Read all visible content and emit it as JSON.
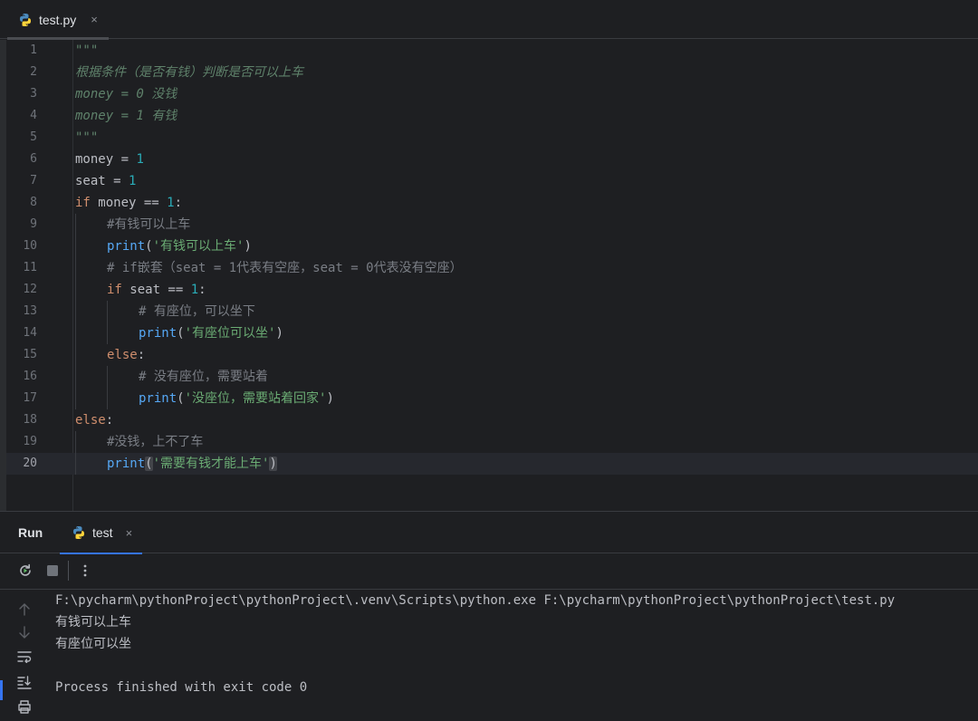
{
  "editor_tab": {
    "label": "test.py",
    "close": "×",
    "icon": "python-icon"
  },
  "code": {
    "line_numbers": [
      "1",
      "2",
      "3",
      "4",
      "5",
      "6",
      "7",
      "8",
      "9",
      "10",
      "11",
      "12",
      "13",
      "14",
      "15",
      "16",
      "17",
      "18",
      "19",
      "20"
    ],
    "current_line": "20",
    "lines": {
      "l1": "\"\"\"",
      "l2": "根据条件（是否有钱）判断是否可以上车",
      "l3": "money = 0 没钱",
      "l4": "money = 1 有钱",
      "l5": "\"\"\"",
      "l6_a": "money = ",
      "l6_b": "1",
      "l7_a": "seat = ",
      "l7_b": "1",
      "l8_a": "if",
      "l8_b": " money == ",
      "l8_c": "1",
      "l8_d": ":",
      "l9": "#有钱可以上车",
      "l10_a": "print",
      "l10_b": "(",
      "l10_c": "'有钱可以上车'",
      "l10_d": ")",
      "l11": "# if嵌套（seat = 1代表有空座，seat = 0代表没有空座）",
      "l12_a": "if",
      "l12_b": " seat == ",
      "l12_c": "1",
      "l12_d": ":",
      "l13": "# 有座位，可以坐下",
      "l14_a": "print",
      "l14_b": "(",
      "l14_c": "'有座位可以坐'",
      "l14_d": ")",
      "l15_a": "else",
      "l15_b": ":",
      "l16": "# 没有座位，需要站着",
      "l17_a": "print",
      "l17_b": "(",
      "l17_c": "'没座位，需要站着回家'",
      "l17_d": ")",
      "l18_a": "else",
      "l18_b": ":",
      "l19": "#没钱，上不了车",
      "l20_a": "print",
      "l20_b": "(",
      "l20_c": "'需要有钱才能上车'",
      "l20_d": ")"
    }
  },
  "run_panel": {
    "title": "Run",
    "tab": {
      "label": "test",
      "close": "×",
      "icon": "python-icon"
    },
    "toolbar": [
      "rerun-icon",
      "stop-icon",
      "more-options-icon"
    ],
    "side_tools": [
      "scroll-up-icon",
      "scroll-down-icon",
      "soft-wrap-icon",
      "scroll-to-end-icon",
      "print-icon"
    ],
    "console": [
      "F:\\pycharm\\pythonProject\\pythonProject\\.venv\\Scripts\\python.exe F:\\pycharm\\pythonProject\\pythonProject\\test.py",
      "有钱可以上车",
      "有座位可以坐",
      "",
      "Process finished with exit code 0"
    ]
  },
  "colors": {
    "background": "#1e1f22",
    "keyword": "#cf8e6d",
    "number": "#2aacb8",
    "string": "#6aab73",
    "docstring": "#5f826b",
    "comment": "#7a7e85",
    "function": "#56a8f5",
    "accent": "#3574f0"
  }
}
